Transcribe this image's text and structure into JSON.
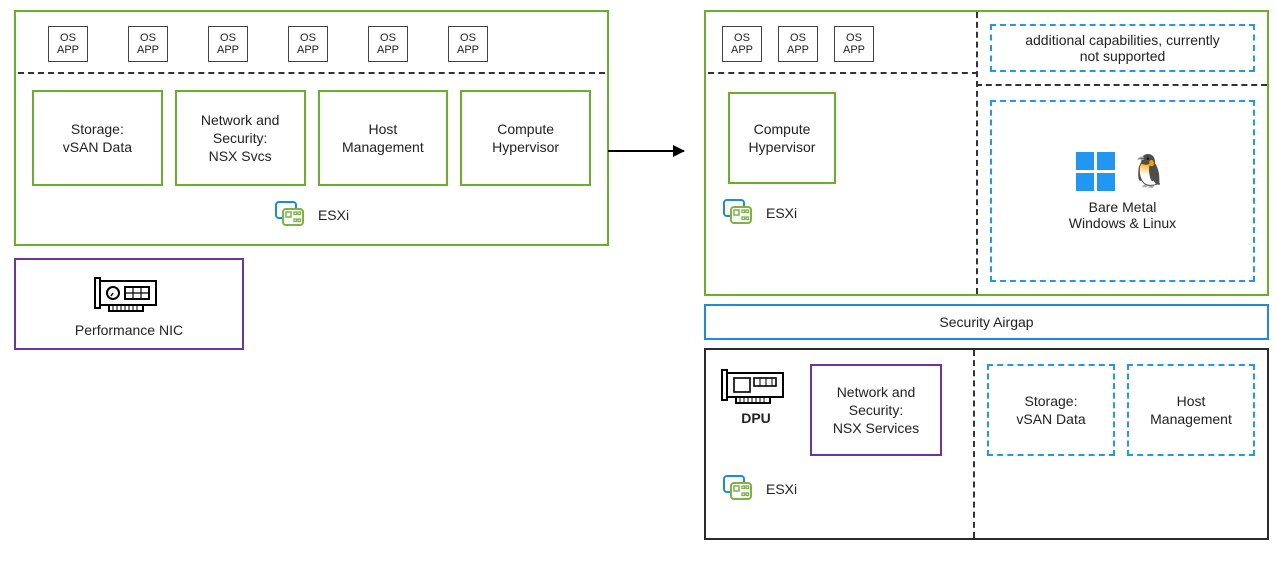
{
  "osapp": {
    "os": "OS",
    "app": "APP"
  },
  "left": {
    "services": [
      "Storage:\nvSAN Data",
      "Network and\nSecurity:\nNSX Svcs",
      "Host\nManagement",
      "Compute\nHypervisor"
    ],
    "esxi": "ESXi",
    "perf_nic": "Performance NIC"
  },
  "right": {
    "top": {
      "compute": "Compute\nHypervisor",
      "esxi": "ESXi",
      "future": "additional capabilities, currently\nnot supported",
      "bare_metal": "Bare Metal\nWindows & Linux"
    },
    "airgap": "Security Airgap",
    "dpu": {
      "label": "DPU",
      "nsx": "Network and\nSecurity:\nNSX Services",
      "esxi": "ESXi",
      "storage": "Storage:\nvSAN Data",
      "host": "Host\nManagement"
    }
  }
}
